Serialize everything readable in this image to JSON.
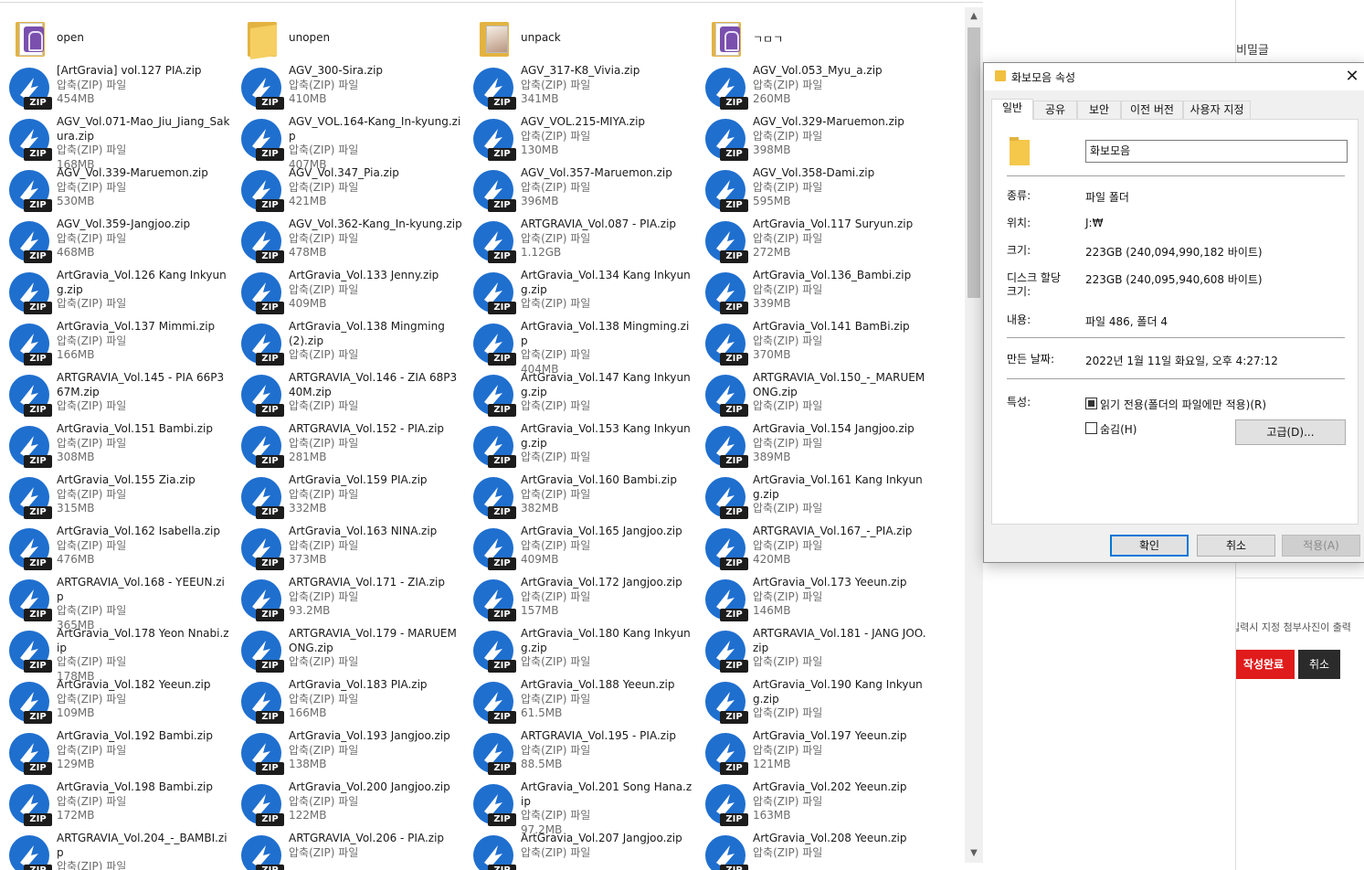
{
  "folders": [
    {
      "name": "open",
      "icon": "rar-folder-icon"
    },
    {
      "name": "unopen",
      "icon": "folder-icon"
    },
    {
      "name": "unpack",
      "icon": "photo-folder-icon"
    },
    {
      "name": "ㄱㅁㄱ",
      "icon": "rar-folder-icon"
    }
  ],
  "file_type_label": "압축(ZIP) 파일",
  "zip_badge": "ZIP",
  "files": [
    [
      "[ArtGravia] vol.127 PIA.zip",
      "454MB"
    ],
    [
      "AGV_300-Sira.zip",
      "410MB"
    ],
    [
      "AGV_317-K8_Vivia.zip",
      "341MB"
    ],
    [
      "AGV_Vol.053_Myu_a.zip",
      "260MB"
    ],
    [
      "AGV_Vol.071-Mao_Jiu_Jiang_Sakura.zip",
      "168MB"
    ],
    [
      "AGV_VOL.164-Kang_In-kyung.zip",
      "407MB"
    ],
    [
      "AGV_VOL.215-MIYA.zip",
      "130MB"
    ],
    [
      "AGV_Vol.329-Maruemon.zip",
      "398MB"
    ],
    [
      "AGV_Vol.339-Maruemon.zip",
      "530MB"
    ],
    [
      "AGV_Vol.347_Pia.zip",
      "421MB"
    ],
    [
      "AGV_Vol.357-Maruemon.zip",
      "396MB"
    ],
    [
      "AGV_Vol.358-Dami.zip",
      "595MB"
    ],
    [
      "AGV_Vol.359-Jangjoo.zip",
      "468MB"
    ],
    [
      "AGV_Vol.362-Kang_In-kyung.zip",
      "478MB"
    ],
    [
      "ARTGRAVIA_Vol.087 - PIA.zip",
      "1.12GB"
    ],
    [
      "ArtGravia_Vol.117 Suryun.zip",
      "272MB"
    ],
    [
      "ArtGravia_Vol.126 Kang Inkyung.zip",
      "파일"
    ],
    [
      "ArtGravia_Vol.133 Jenny.zip",
      "409MB"
    ],
    [
      "ArtGravia_Vol.134 Kang Inkyung.zip",
      "파일"
    ],
    [
      "ArtGravia_Vol.136_Bambi.zip",
      "339MB"
    ],
    [
      "ArtGravia_Vol.137 Mimmi.zip",
      "166MB"
    ],
    [
      "ArtGravia_Vol.138 Mingming (2).zip",
      "파일"
    ],
    [
      "ArtGravia_Vol.138 Mingming.zip",
      "404MB"
    ],
    [
      "ArtGravia_Vol.141 BamBi.zip",
      "370MB"
    ],
    [
      "ARTGRAVIA_Vol.145 - PIA 66P367M.zip",
      "파일"
    ],
    [
      "ARTGRAVIA_Vol.146 - ZIA 68P340M.zip",
      "파일"
    ],
    [
      "ArtGravia_Vol.147 Kang Inkyung.zip",
      "파일"
    ],
    [
      "ARTGRAVIA_Vol.150_-_MARUEMONG.zip",
      "파일"
    ],
    [
      "ArtGravia_Vol.151 Bambi.zip",
      "308MB"
    ],
    [
      "ARTGRAVIA_Vol.152 - PIA.zip",
      "281MB"
    ],
    [
      "ArtGravia_Vol.153 Kang Inkyung.zip",
      "파일"
    ],
    [
      "ArtGravia_Vol.154 Jangjoo.zip",
      "389MB"
    ],
    [
      "ArtGravia_Vol.155 Zia.zip",
      "315MB"
    ],
    [
      "ArtGravia_Vol.159 PIA.zip",
      "332MB"
    ],
    [
      "ArtGravia_Vol.160 Bambi.zip",
      "382MB"
    ],
    [
      "ArtGravia_Vol.161 Kang Inkyung.zip",
      "파일"
    ],
    [
      "ArtGravia_Vol.162 Isabella.zip",
      "476MB"
    ],
    [
      "ArtGravia_Vol.163 NINA.zip",
      "373MB"
    ],
    [
      "ArtGravia_Vol.165 Jangjoo.zip",
      "409MB"
    ],
    [
      "ARTGRAVIA_Vol.167_-_PIA.zip",
      "420MB"
    ],
    [
      "ARTGRAVIA_Vol.168 - YEEUN.zip",
      "365MB"
    ],
    [
      "ARTGRAVIA_Vol.171 - ZIA.zip",
      "93.2MB"
    ],
    [
      "ArtGravia_Vol.172 Jangjoo.zip",
      "157MB"
    ],
    [
      "ArtGravia_Vol.173 Yeeun.zip",
      "146MB"
    ],
    [
      "ArtGravia_Vol.178 Yeon Nnabi.zip",
      "178MB"
    ],
    [
      "ARTGRAVIA_Vol.179 - MARUEMONG.zip",
      "파일"
    ],
    [
      "ArtGravia_Vol.180 Kang Inkyung.zip",
      "파일"
    ],
    [
      "ARTGRAVIA_Vol.181 - JANG JOO.zip",
      "파일"
    ],
    [
      "ArtGravia_Vol.182 Yeeun.zip",
      "109MB"
    ],
    [
      "ArtGravia_Vol.183 PIA.zip",
      "166MB"
    ],
    [
      "ArtGravia_Vol.188 Yeeun.zip",
      "61.5MB"
    ],
    [
      "ArtGravia_Vol.190 Kang Inkyung.zip",
      "파일"
    ],
    [
      "ArtGravia_Vol.192 Bambi.zip",
      "129MB"
    ],
    [
      "ArtGravia_Vol.193 Jangjoo.zip",
      "138MB"
    ],
    [
      "ARTGRAVIA_Vol.195 - PIA.zip",
      "88.5MB"
    ],
    [
      "ArtGravia_Vol.197 Yeeun.zip",
      "121MB"
    ],
    [
      "ArtGravia_Vol.198 Bambi.zip",
      "172MB"
    ],
    [
      "ArtGravia_Vol.200 Jangjoo.zip",
      "122MB"
    ],
    [
      "ArtGravia_Vol.201 Song Hana.zip",
      "97.2MB"
    ],
    [
      "ArtGravia_Vol.202 Yeeun.zip",
      "163MB"
    ],
    [
      "ARTGRAVIA_Vol.204_-_BAMBI.zip",
      ""
    ],
    [
      "ARTGRAVIA_Vol.206 - PIA.zip",
      ""
    ],
    [
      "ArtGravia_Vol.207 Jangjoo.zip",
      ""
    ],
    [
      "ArtGravia_Vol.208 Yeeun.zip",
      ""
    ]
  ],
  "background_page": {
    "password_label": "비밀글",
    "notice": "입력시 지정 첨부사진이 출력",
    "submit_label": "작성완료",
    "cancel_label": "취소"
  },
  "dialog": {
    "title": "화보모음 속성",
    "close": "✕",
    "tabs": [
      "일반",
      "공유",
      "보안",
      "이전 버전",
      "사용자 지정"
    ],
    "folder_name": "화보모음",
    "rows": {
      "type_label": "종류:",
      "type_value": "파일 폴더",
      "location_label": "위치:",
      "location_value": "J:₩",
      "size_label": "크기:",
      "size_value": "223GB (240,094,990,182 바이트)",
      "disk_label": "디스크 할당 크기:",
      "disk_value": "223GB (240,095,940,608 바이트)",
      "contents_label": "내용:",
      "contents_value": "파일 486, 폴더 4",
      "created_label": "만든 날짜:",
      "created_value": "2022년 1월 11일 화요일, 오후 4:27:12",
      "attr_label": "특성:",
      "readonly_label": "읽기 전용(폴더의 파일에만 적용)(R)",
      "hidden_label": "숨김(H)",
      "advanced_label": "고급(D)..."
    },
    "ok_label": "확인",
    "cancel_label": "취소",
    "apply_label": "적용(A)"
  },
  "colors": {
    "zip_blue": "#1f6fcf",
    "folder_yellow": "#f5cf62",
    "default_button_border": "#0078d7",
    "submit_red": "#e01b1b"
  }
}
